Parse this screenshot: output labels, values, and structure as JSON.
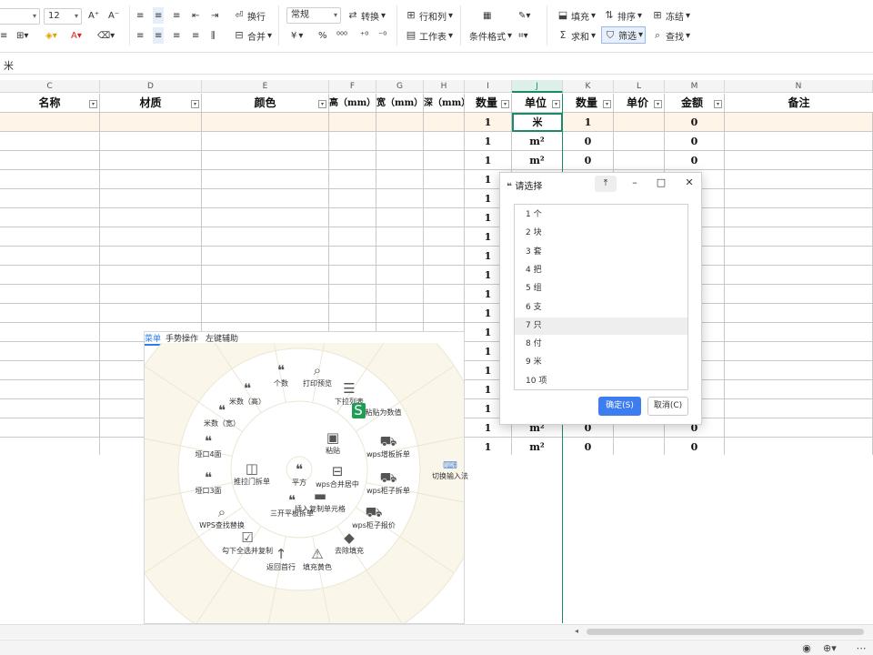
{
  "ribbon": {
    "font_size": "12",
    "increase_font": "A⁺",
    "decrease_font": "A⁻",
    "wrap": "换行",
    "number_format": "常规",
    "convert": "转换",
    "row_col": "行和列",
    "fill": "填充",
    "sort": "排序",
    "freeze": "冻结",
    "merge": "合并",
    "currency": "¥",
    "percent": "%",
    "dec_inc": "⁰⁰⁰",
    "worksheet": "工作表",
    "cond_format": "条件格式",
    "sum": "求和",
    "filter": "筛选",
    "find": "查找"
  },
  "formula_bar": {
    "content": "米"
  },
  "columns": [
    "C",
    "D",
    "E",
    "F",
    "G",
    "H",
    "I",
    "J",
    "K",
    "L",
    "M",
    "N"
  ],
  "headers": [
    "名称",
    "材质",
    "颜色",
    "高（mm）",
    "宽（mm）",
    "深（mm）",
    "数量",
    "单位",
    "数量",
    "单价",
    "金额",
    "备注"
  ],
  "rows": [
    [
      "",
      "",
      "",
      "",
      "",
      "",
      "1",
      "米",
      "1",
      "",
      "0",
      ""
    ],
    [
      "",
      "",
      "",
      "",
      "",
      "",
      "1",
      "m²",
      "0",
      "",
      "0",
      ""
    ],
    [
      "",
      "",
      "",
      "",
      "",
      "",
      "1",
      "m²",
      "0",
      "",
      "0",
      ""
    ],
    [
      "",
      "",
      "",
      "",
      "",
      "",
      "1",
      "",
      "",
      "",
      "",
      ""
    ],
    [
      "",
      "",
      "",
      "",
      "",
      "",
      "1",
      "",
      "",
      "",
      "",
      ""
    ],
    [
      "",
      "",
      "",
      "",
      "",
      "",
      "1",
      "",
      "",
      "",
      "",
      ""
    ],
    [
      "",
      "",
      "",
      "",
      "",
      "",
      "1",
      "",
      "",
      "",
      "",
      ""
    ],
    [
      "",
      "",
      "",
      "",
      "",
      "",
      "1",
      "",
      "",
      "",
      "",
      ""
    ],
    [
      "",
      "",
      "",
      "",
      "",
      "",
      "1",
      "",
      "",
      "",
      "",
      ""
    ],
    [
      "",
      "",
      "",
      "",
      "",
      "",
      "1",
      "",
      "",
      "",
      "",
      ""
    ],
    [
      "",
      "",
      "",
      "",
      "",
      "",
      "1",
      "",
      "",
      "",
      "",
      ""
    ],
    [
      "",
      "",
      "",
      "",
      "",
      "",
      "1",
      "",
      "",
      "",
      "",
      ""
    ],
    [
      "",
      "",
      "",
      "",
      "",
      "",
      "1",
      "",
      "",
      "",
      "",
      ""
    ],
    [
      "",
      "",
      "",
      "",
      "",
      "",
      "1",
      "",
      "",
      "",
      "",
      ""
    ],
    [
      "",
      "",
      "",
      "",
      "",
      "",
      "1",
      "",
      "",
      "",
      "",
      ""
    ],
    [
      "",
      "",
      "",
      "",
      "",
      "",
      "1",
      "",
      "",
      "",
      "",
      ""
    ],
    [
      "",
      "",
      "",
      "",
      "",
      "",
      "1",
      "m²",
      "0",
      "",
      "0",
      ""
    ],
    [
      "",
      "",
      "",
      "",
      "",
      "",
      "1",
      "m²",
      "0",
      "",
      "0",
      ""
    ]
  ],
  "dialog": {
    "title": "请选择",
    "items": [
      "1 个",
      "2 块",
      "3 套",
      "4 把",
      "5 组",
      "6 支",
      "7 只",
      "8 付",
      "9 米",
      "10 项"
    ],
    "ok": "确定(S)",
    "cancel": "取消(C)"
  },
  "radial_menu": {
    "tabs": [
      "菜单",
      "手势操作",
      "左键辅助"
    ],
    "items": [
      {
        "label": "个数",
        "icon": "quote-icon"
      },
      {
        "label": "打印预览",
        "icon": "preview-icon"
      },
      {
        "label": "下拉列表",
        "icon": "list-icon"
      },
      {
        "label": "粘贴为数值",
        "icon": "paste-value-icon"
      },
      {
        "label": "wps增板拆单",
        "icon": "truck-icon"
      },
      {
        "label": "wps柜子拆单",
        "icon": "truck-icon"
      },
      {
        "label": "wps柜子报价",
        "icon": "truck-icon"
      },
      {
        "label": "去除填充",
        "icon": "bucket-icon"
      },
      {
        "label": "填充黄色",
        "icon": "fill-icon"
      },
      {
        "label": "返回首行",
        "icon": "up-arrow-icon"
      },
      {
        "label": "勾下全选并复制",
        "icon": "checkbox-icon"
      },
      {
        "label": "WPS查找替换",
        "icon": "search-icon"
      },
      {
        "label": "垭口3面",
        "icon": "quote-icon"
      },
      {
        "label": "垭口4面",
        "icon": "quote-icon"
      },
      {
        "label": "米数（宽）",
        "icon": "quote-icon"
      },
      {
        "label": "米数（高）",
        "icon": "quote-icon"
      },
      {
        "label": "粘贴",
        "icon": "paste-icon"
      },
      {
        "label": "wps合并居中",
        "icon": "merge-icon"
      },
      {
        "label": "插入复制单元格",
        "icon": "insert-icon"
      },
      {
        "label": "三开平板拆单",
        "icon": "quote-icon"
      },
      {
        "label": "推拉门拆单",
        "icon": "door-icon"
      },
      {
        "label": "平方",
        "icon": "quote-icon"
      }
    ],
    "side_button": "切换输入法"
  }
}
